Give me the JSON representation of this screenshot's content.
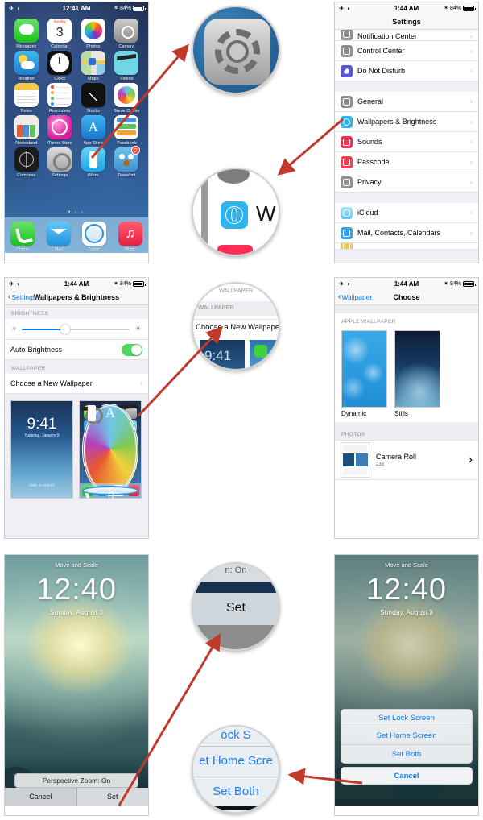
{
  "panels": {
    "home": {
      "status": {
        "time": "12:41 AM",
        "battery": "84%",
        "airplane": "airplane-icon",
        "wifi": "wifi-icon",
        "bluetooth": "bluetooth-icon"
      },
      "apps": [
        {
          "label": "Messages",
          "icon": "messages-icon"
        },
        {
          "label": "Calendar",
          "icon": "calendar-icon",
          "day": "3",
          "weekday": "Sunday"
        },
        {
          "label": "Photos",
          "icon": "photos-icon"
        },
        {
          "label": "Camera",
          "icon": "camera-icon"
        },
        {
          "label": "Weather",
          "icon": "weather-icon"
        },
        {
          "label": "Clock",
          "icon": "clock-icon"
        },
        {
          "label": "Maps",
          "icon": "maps-icon"
        },
        {
          "label": "Videos",
          "icon": "videos-icon"
        },
        {
          "label": "Notes",
          "icon": "notes-icon"
        },
        {
          "label": "Reminders",
          "icon": "reminders-icon"
        },
        {
          "label": "Stocks",
          "icon": "stocks-icon"
        },
        {
          "label": "Game Center",
          "icon": "game-center-icon"
        },
        {
          "label": "Newsstand",
          "icon": "newsstand-icon"
        },
        {
          "label": "iTunes Store",
          "icon": "itunes-store-icon"
        },
        {
          "label": "App Store",
          "icon": "app-store-icon"
        },
        {
          "label": "Passbook",
          "icon": "passbook-icon"
        },
        {
          "label": "Compass",
          "icon": "compass-icon"
        },
        {
          "label": "Settings",
          "icon": "settings-icon"
        },
        {
          "label": "iMore",
          "icon": "imore-icon"
        },
        {
          "label": "Tweetbot",
          "icon": "tweetbot-icon",
          "badge": "2"
        }
      ],
      "page_dots": "• ◦ ◦",
      "dock": [
        {
          "label": "Phone",
          "icon": "phone-icon"
        },
        {
          "label": "Mail",
          "icon": "mail-icon"
        },
        {
          "label": "Safari",
          "icon": "safari-icon"
        },
        {
          "label": "Music",
          "icon": "music-icon"
        }
      ]
    },
    "settings": {
      "status": {
        "time": "1:44 AM",
        "battery": "84%"
      },
      "title": "Settings",
      "rows_group1": [
        {
          "label": "Notification Center",
          "icon": "notification-center-icon"
        },
        {
          "label": "Control Center",
          "icon": "control-center-icon"
        },
        {
          "label": "Do Not Disturb",
          "icon": "do-not-disturb-icon"
        }
      ],
      "rows_group2": [
        {
          "label": "General",
          "icon": "general-icon"
        },
        {
          "label": "Wallpapers & Brightness",
          "icon": "wallpapers-icon"
        },
        {
          "label": "Sounds",
          "icon": "sounds-icon"
        },
        {
          "label": "Passcode",
          "icon": "passcode-icon"
        },
        {
          "label": "Privacy",
          "icon": "privacy-icon"
        }
      ],
      "rows_group3": [
        {
          "label": "iCloud",
          "icon": "icloud-icon"
        },
        {
          "label": "Mail, Contacts, Calendars",
          "icon": "mail-icon"
        }
      ],
      "chevron": "›"
    },
    "wallpapers": {
      "status": {
        "time": "1:44 AM",
        "battery": "84%"
      },
      "back": "Settings",
      "title": "Wallpapers & Brightness",
      "brightness_header": "BRIGHTNESS",
      "brightness_value": 40,
      "auto_brightness_label": "Auto-Brightness",
      "auto_brightness_on": true,
      "wallpaper_header": "WALLPAPER",
      "choose_label": "Choose a New Wallpaper",
      "chevron": "›",
      "lock_preview": {
        "time": "9:41",
        "date": "Tuesday, January 9",
        "slide": "slide to unlock"
      }
    },
    "choose": {
      "status": {
        "time": "1:44 AM",
        "battery": "84%"
      },
      "back": "Wallpaper",
      "title": "Choose",
      "apple_header": "APPLE WALLPAPER",
      "items": [
        {
          "caption": "Dynamic"
        },
        {
          "caption": "Stills"
        }
      ],
      "photos_header": "PHOTOS",
      "camera_roll": {
        "name": "Camera Roll",
        "count": "233",
        "chevron": "›"
      }
    },
    "move_scale": {
      "header": "Move and Scale",
      "time": "12:40",
      "date": "Sunday, August 3",
      "perspective_zoom": "Perspective Zoom: On",
      "cancel": "Cancel",
      "set": "Set"
    },
    "action_sheet": {
      "header": "Move and Scale",
      "time": "12:40",
      "date": "Sunday, August 3",
      "options": [
        "Set Lock Screen",
        "Set Home Screen",
        "Set Both"
      ],
      "cancel": "Cancel"
    }
  },
  "callouts": {
    "settings_icon": {
      "name": "settings-icon-zoom"
    },
    "wallpapers_row": {
      "text": "W"
    },
    "choose_wallpaper": {
      "header": "WALLPAPER",
      "label": "Choose a New Wallpaper",
      "time": "9:41"
    },
    "set_button": {
      "label": "Set",
      "above": "n: On"
    },
    "set_both": {
      "top": "ock S",
      "middle": "et Home Scre",
      "bottom": "Set Both"
    }
  },
  "colors": {
    "accent_blue": "#0a7bf0",
    "arrow_red": "#c0392b",
    "toggle_green": "#4cd763",
    "badge_red": "#e8453c"
  }
}
